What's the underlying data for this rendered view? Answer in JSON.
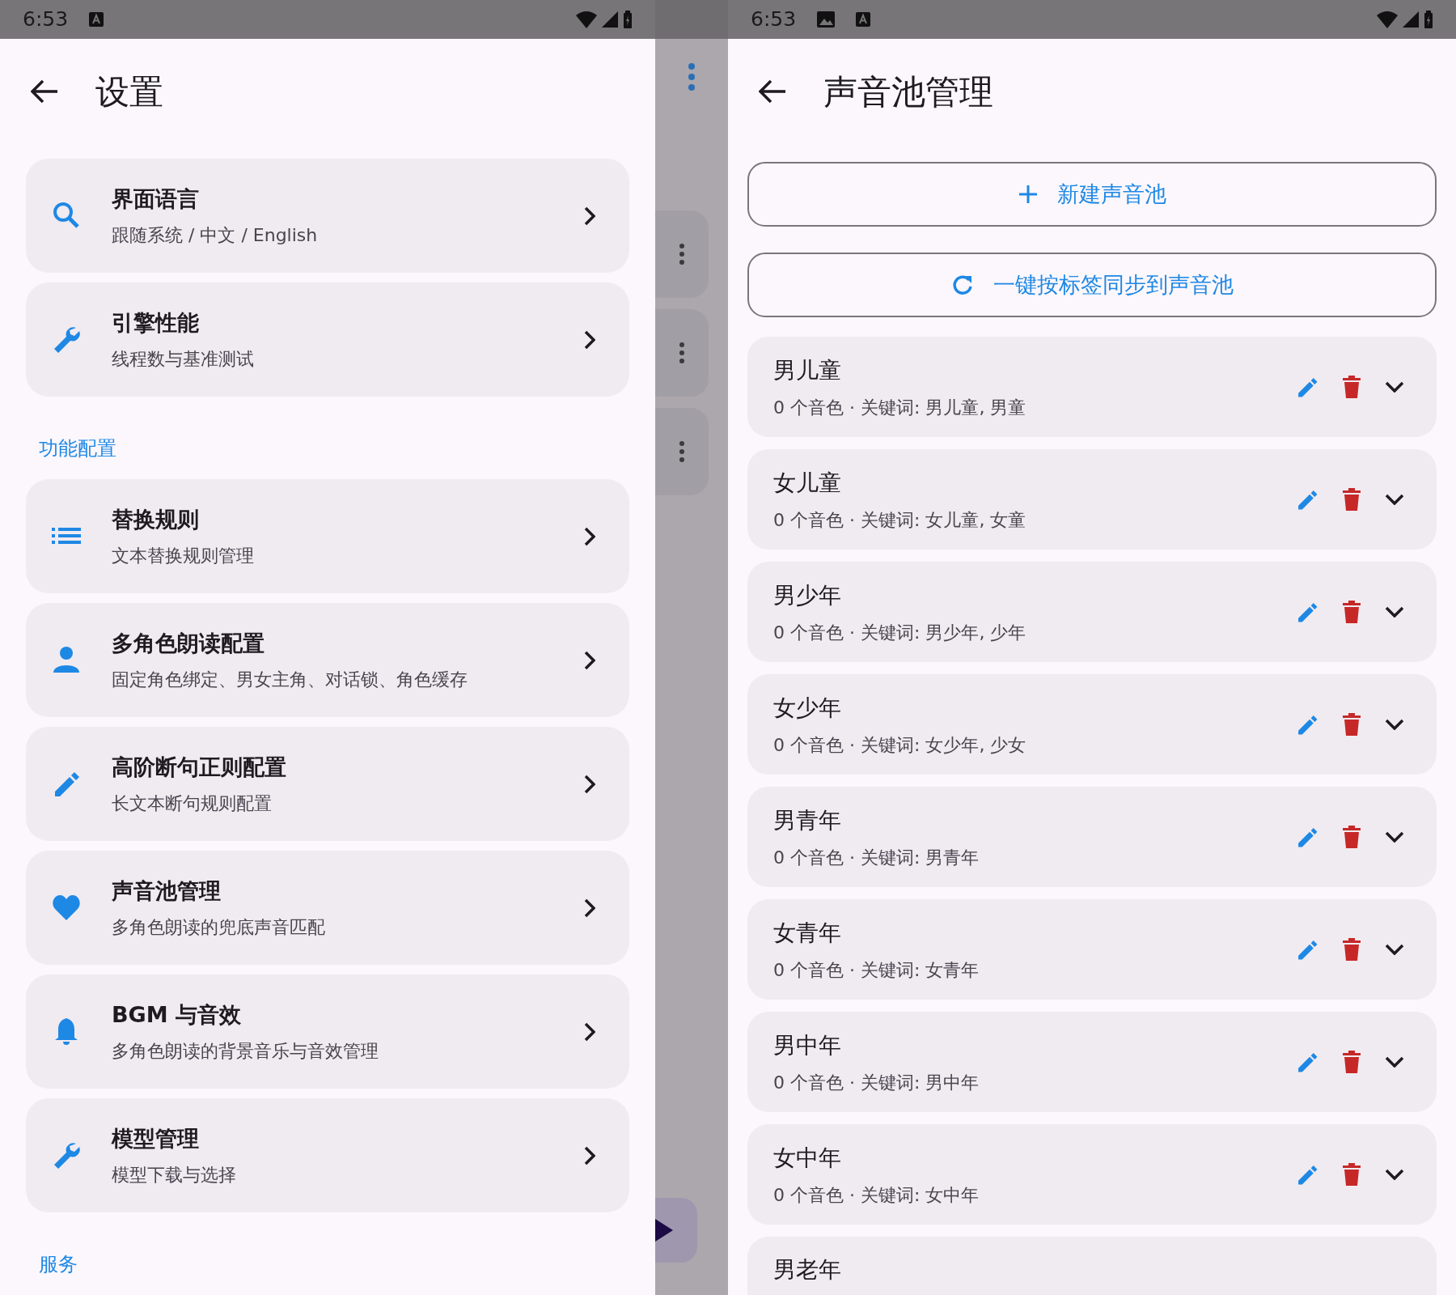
{
  "left": {
    "status_bar": {
      "time": "6:53"
    },
    "title": "设置",
    "sections": [
      {
        "items": [
          {
            "title": "界面语言",
            "subtitle": "跟随系统 / 中文 / English"
          },
          {
            "title": "引擎性能",
            "subtitle": "线程数与基准测试"
          }
        ]
      },
      {
        "header": "功能配置",
        "items": [
          {
            "title": "替换规则",
            "subtitle": "文本替换规则管理"
          },
          {
            "title": "多角色朗读配置",
            "subtitle": "固定角色绑定、男女主角、对话锁、角色缓存"
          },
          {
            "title": "高阶断句正则配置",
            "subtitle": "长文本断句规则配置"
          },
          {
            "title": "声音池管理",
            "subtitle": "多角色朗读的兜底声音匹配"
          },
          {
            "title": "BGM 与音效",
            "subtitle": "多角色朗读的背景音乐与音效管理"
          },
          {
            "title": "模型管理",
            "subtitle": "模型下载与选择"
          }
        ]
      },
      {
        "header": "服务"
      }
    ]
  },
  "right": {
    "status_bar": {
      "time": "6:53"
    },
    "title": "声音池管理",
    "buttons": [
      {
        "label": "新建声音池"
      },
      {
        "label": "一键按标签同步到声音池"
      }
    ],
    "pools": [
      {
        "name": "男儿童",
        "detail": "0 个音色 · 关键词: 男儿童, 男童"
      },
      {
        "name": "女儿童",
        "detail": "0 个音色 · 关键词: 女儿童, 女童"
      },
      {
        "name": "男少年",
        "detail": "0 个音色 · 关键词: 男少年, 少年"
      },
      {
        "name": "女少年",
        "detail": "0 个音色 · 关键词: 女少年, 少女"
      },
      {
        "name": "男青年",
        "detail": "0 个音色 · 关键词: 男青年"
      },
      {
        "name": "女青年",
        "detail": "0 个音色 · 关键词: 女青年"
      },
      {
        "name": "男中年",
        "detail": "0 个音色 · 关键词: 男中年"
      },
      {
        "name": "女中年",
        "detail": "0 个音色 · 关键词: 女中年"
      },
      {
        "name": "男老年"
      }
    ]
  }
}
